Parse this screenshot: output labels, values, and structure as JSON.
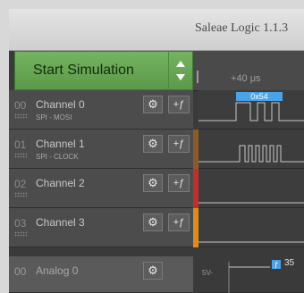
{
  "window": {
    "title": "Saleae Logic 1.1.3"
  },
  "simulation": {
    "label": "Start Simulation"
  },
  "timeline": {
    "time_label": "+40 μs"
  },
  "channels": [
    {
      "number": "00",
      "name": "Channel 0",
      "subtitle": "SPI - MOSI",
      "color": "#3a3a3a"
    },
    {
      "number": "01",
      "name": "Channel 1",
      "subtitle": "SPI - CLOCK",
      "color": "#8b5a2b"
    },
    {
      "number": "02",
      "name": "Channel 2",
      "subtitle": "",
      "color": "#c0302a"
    },
    {
      "number": "03",
      "name": "Channel 3",
      "subtitle": "",
      "color": "#e08a1e"
    }
  ],
  "analog": {
    "number": "00",
    "name": "Analog 0",
    "axis_label": "5V-",
    "measurement": "35"
  },
  "decoded": {
    "mosi_value": "0x54"
  },
  "icons": {
    "gear": "gear-icon",
    "trigger": "trigger-icon"
  }
}
